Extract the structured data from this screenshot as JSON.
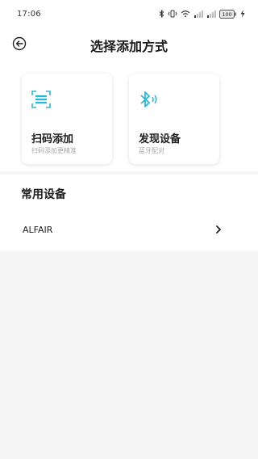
{
  "status_bar": {
    "time": "17:06",
    "battery": "100"
  },
  "header": {
    "title": "选择添加方式"
  },
  "methods": [
    {
      "title": "扫码添加",
      "subtitle": "扫码添加更精准",
      "icon": "qr-scan-icon"
    },
    {
      "title": "发现设备",
      "subtitle": "蓝牙配对",
      "icon": "bluetooth-icon"
    }
  ],
  "common_devices": {
    "title": "常用设备",
    "items": [
      {
        "name": "ALFAIR"
      }
    ]
  },
  "colors": {
    "accent": "#2bb6d6",
    "background": "#f5f5f6"
  }
}
